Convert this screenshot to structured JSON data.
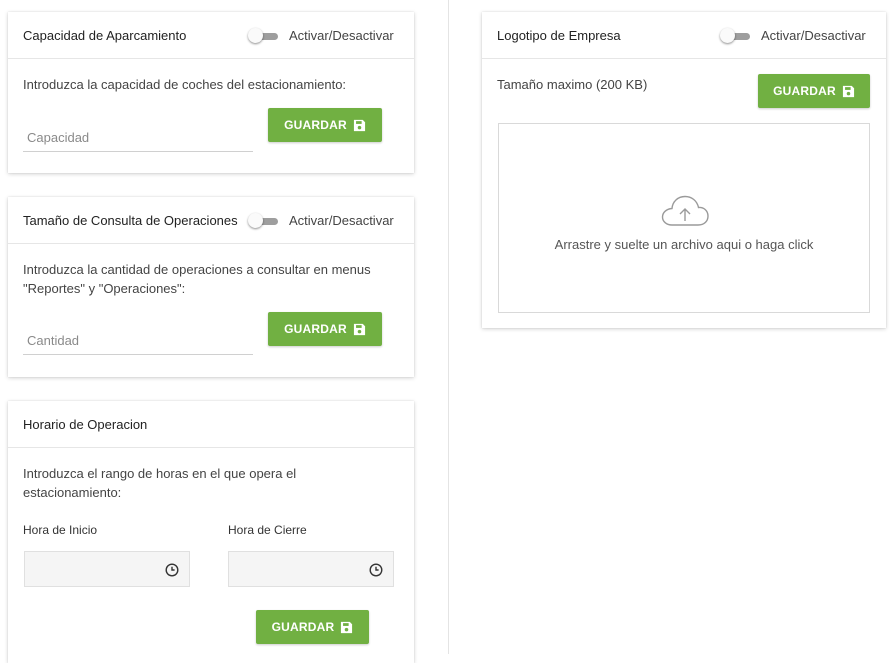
{
  "parking_capacity": {
    "title": "Capacidad de Aparcamiento",
    "toggle_label": "Activar/Desactivar",
    "description": "Introduzca la capacidad de coches del estacionamiento:",
    "input_placeholder": "Capacidad",
    "input_value": "",
    "save_label": "GUARDAR"
  },
  "operations_query": {
    "title": "Tamaño de Consulta de Operaciones",
    "toggle_label": "Activar/Desactivar",
    "description": "Introduzca la cantidad de operaciones a consultar en menus \"Reportes\" y \"Operaciones\":",
    "input_placeholder": "Cantidad",
    "input_value": "",
    "save_label": "GUARDAR"
  },
  "operating_hours": {
    "title": "Horario de Operacion",
    "description": "Introduzca el rango de horas en el que opera el estacionamiento:",
    "start_label": "Hora de Inicio",
    "end_label": "Hora de Cierre",
    "start_value": "",
    "end_value": "",
    "save_label": "GUARDAR"
  },
  "company_logo": {
    "title": "Logotipo de Empresa",
    "toggle_label": "Activar/Desactivar",
    "max_size": "Tamaño maximo (200 KB)",
    "save_label": "GUARDAR",
    "dropzone_text": "Arrastre y suelte un archivo aqui o haga click"
  },
  "colors": {
    "button_green": "#71b042",
    "toggle_track": "#9e9e9e"
  },
  "icons": [
    "toggle-switch",
    "save-icon",
    "clock-icon",
    "cloud-upload-icon"
  ]
}
